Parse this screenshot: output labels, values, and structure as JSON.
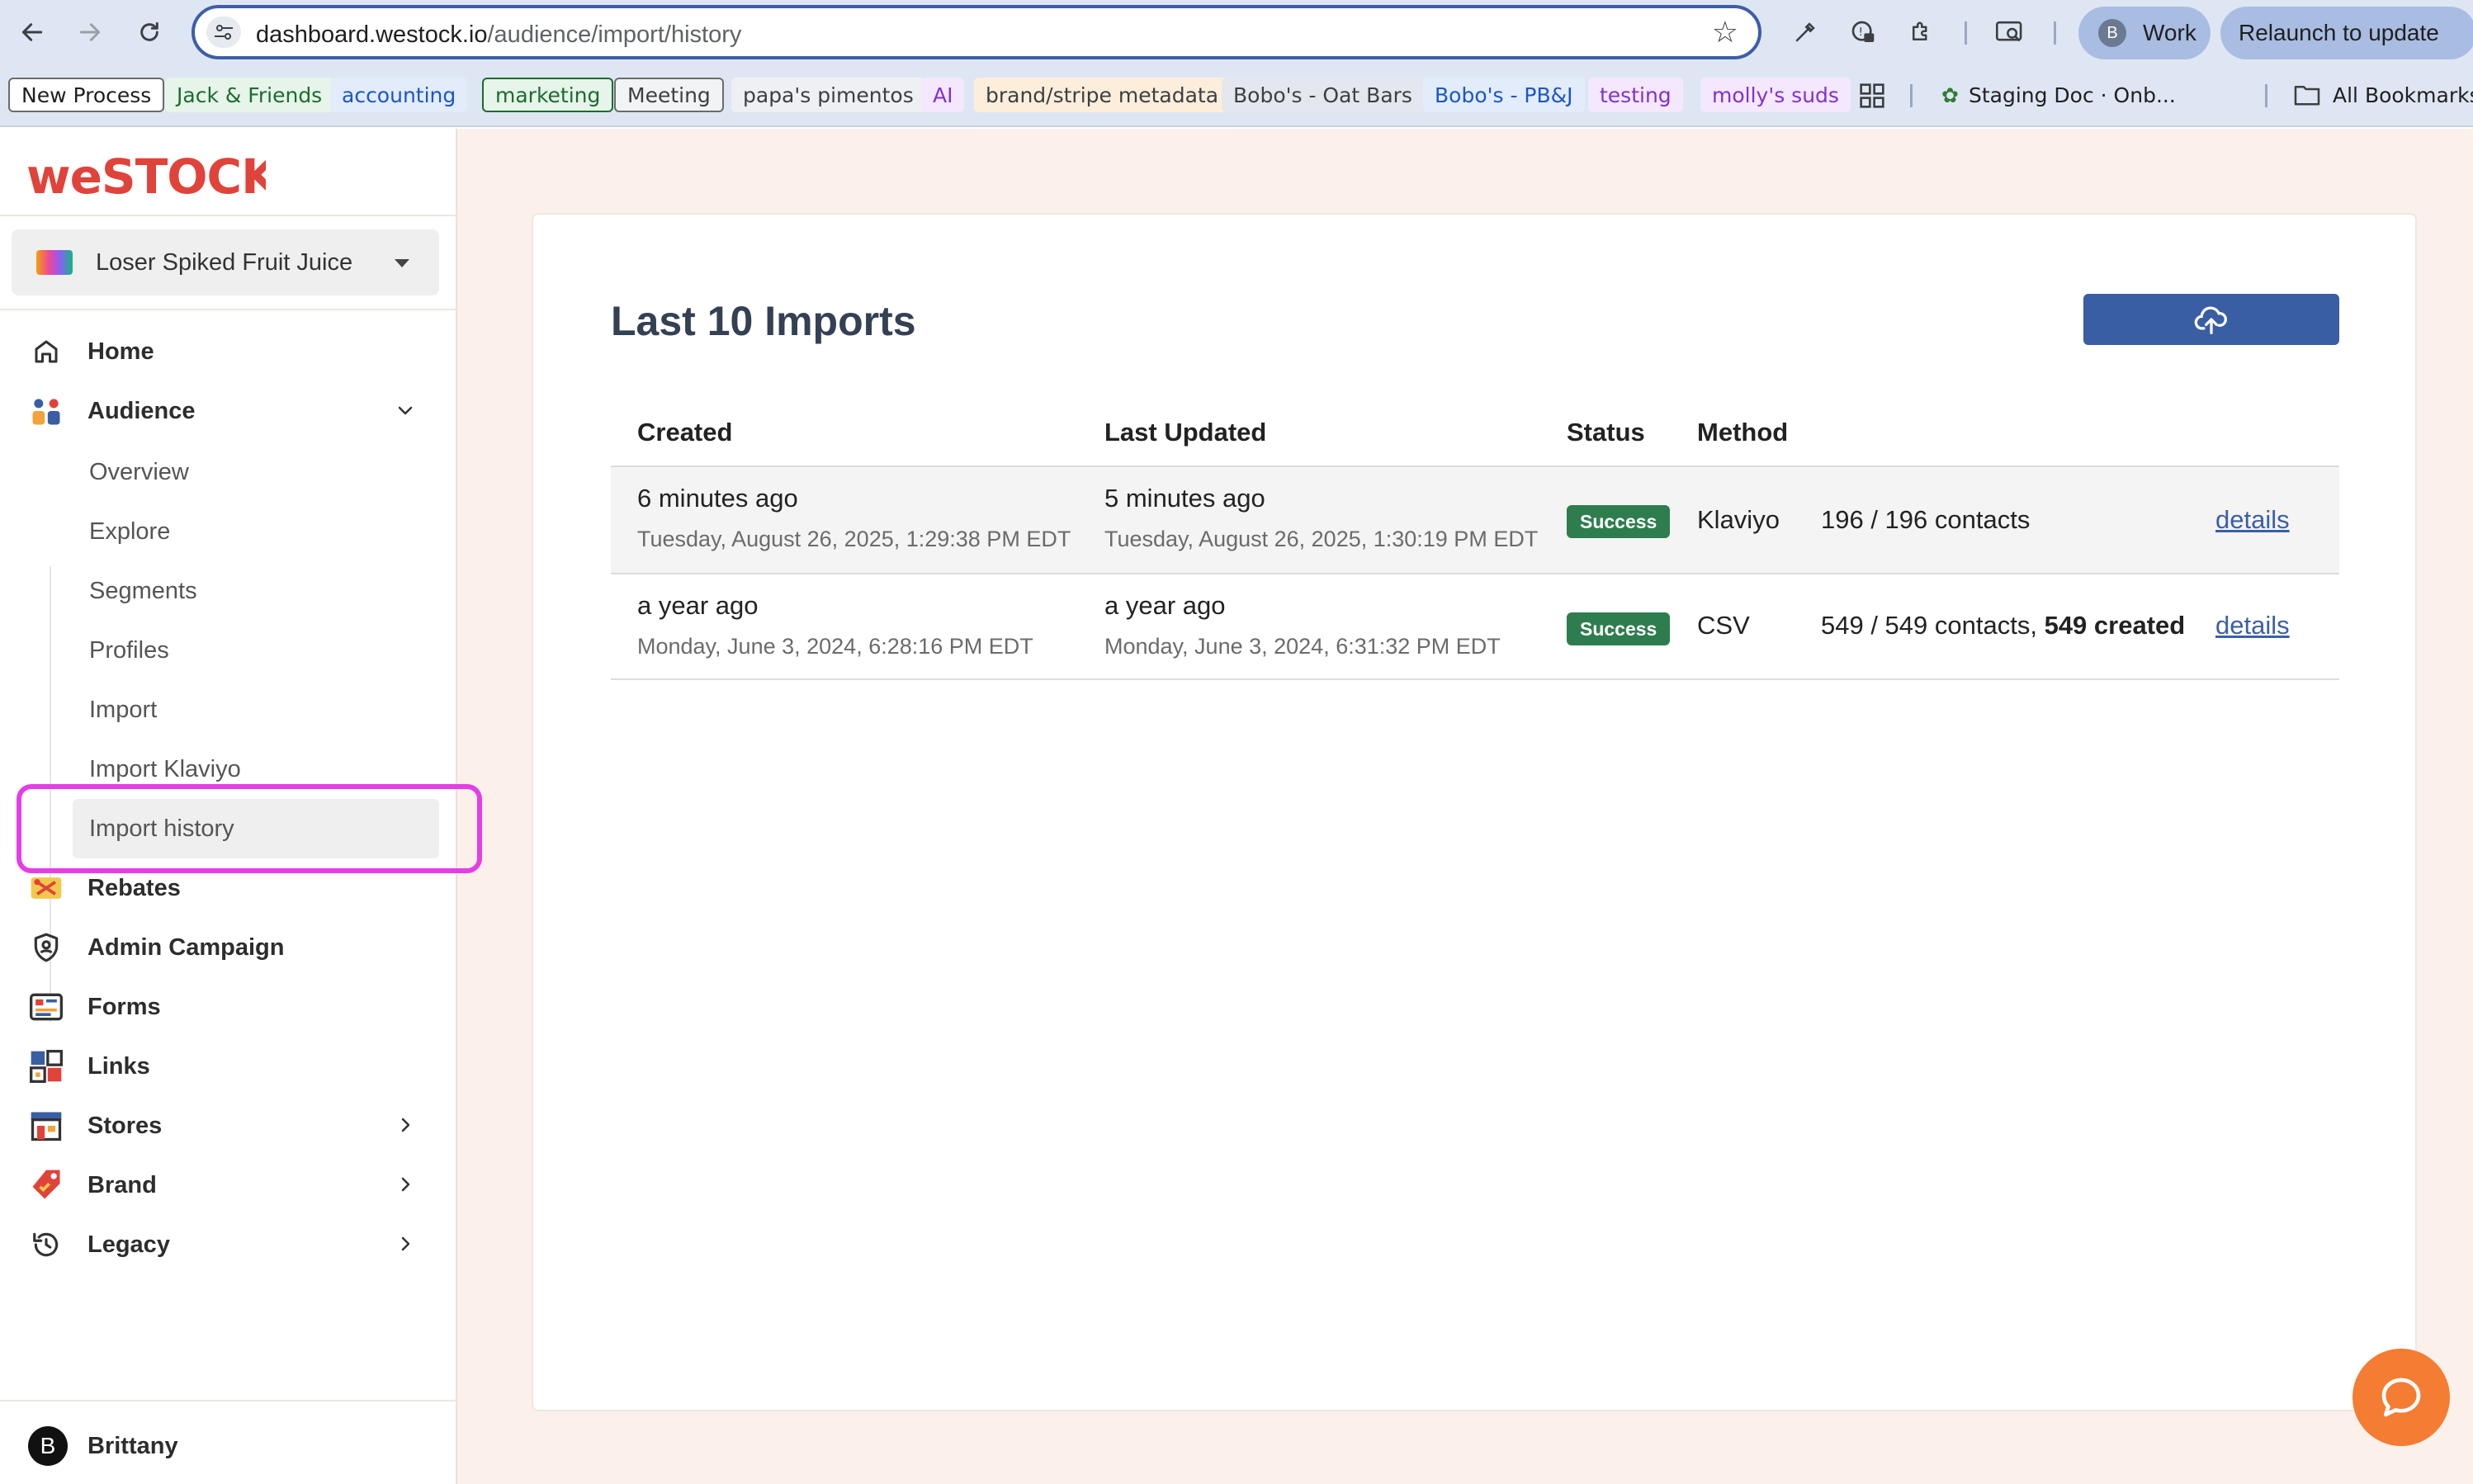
{
  "browser": {
    "url_host": "dashboard.westock.io",
    "url_path": "/audience/import/history",
    "profile_initial": "B",
    "profile_name": "Work",
    "relaunch_label": "Relaunch to update",
    "bookmarks": [
      {
        "label": "New Process",
        "color": "#1f1f1f",
        "bg": "#ffffff",
        "border": "#6b6b6b"
      },
      {
        "label": "Jack & Friends",
        "color": "#1e6b2e",
        "bg": "#e6f4ea",
        "border": "none"
      },
      {
        "label": "accounting",
        "color": "#1a56c9",
        "bg": "#e3ecfb",
        "border": "none"
      },
      {
        "label": "marketing",
        "color": "#1e6b2e",
        "bg": "#e6f4ea",
        "border": "#1e6b2e"
      },
      {
        "label": "Meeting",
        "color": "#3c4043",
        "bg": "#f1f3f4",
        "border": "#6b6b6b"
      },
      {
        "label": "papa's pimentos",
        "color": "#3c4043",
        "bg": "#eef0f3",
        "border": "none"
      },
      {
        "label": "AI",
        "color": "#8430ce",
        "bg": "#f3e8fd",
        "border": "none"
      },
      {
        "label": "brand/stripe metadata",
        "color": "#3c4043",
        "bg": "#fdeedb",
        "border": "none"
      },
      {
        "label": "Bobo's - Oat Bars",
        "color": "#3c4043",
        "bg": "#e4e8ee",
        "border": "none"
      },
      {
        "label": "Bobo's - PB&J",
        "color": "#1a56c9",
        "bg": "#e3ecfb",
        "border": "none"
      },
      {
        "label": "testing",
        "color": "#8430ce",
        "bg": "#f3e8fd",
        "border": "none"
      },
      {
        "label": "molly's suds",
        "color": "#8430ce",
        "bg": "#f3e8fd",
        "border": "none"
      }
    ],
    "staging_label": "Staging Doc · Onb...",
    "all_bookmarks_label": "All Bookmarks"
  },
  "sidebar": {
    "brand_name": "Loser Spiked Fruit Juice",
    "nav": {
      "home": "Home",
      "audience": "Audience",
      "rebates": "Rebates",
      "admin_campaign": "Admin Campaign",
      "forms": "Forms",
      "links": "Links",
      "stores": "Stores",
      "brand": "Brand",
      "legacy": "Legacy"
    },
    "audience_sub": {
      "overview": "Overview",
      "explore": "Explore",
      "segments": "Segments",
      "profiles": "Profiles",
      "import": "Import",
      "import_klaviyo": "Import Klaviyo",
      "import_history": "Import history"
    },
    "user_initial": "B",
    "user_name": "Brittany"
  },
  "main": {
    "title": "Last 10 Imports",
    "columns": {
      "created": "Created",
      "last_updated": "Last Updated",
      "status": "Status",
      "method": "Method"
    },
    "rows": [
      {
        "created_rel": "6 minutes ago",
        "created_abs": "Tuesday, August 26, 2025, 1:29:38 PM EDT",
        "updated_rel": "5 minutes ago",
        "updated_abs": "Tuesday, August 26, 2025, 1:30:19 PM EDT",
        "status": "Success",
        "method": "Klaviyo",
        "summary": "196 / 196 contacts",
        "created_note": "",
        "details": "details"
      },
      {
        "created_rel": "a year ago",
        "created_abs": "Monday, June 3, 2024, 6:28:16 PM EDT",
        "updated_rel": "a year ago",
        "updated_abs": "Monday, June 3, 2024, 6:31:32 PM EDT",
        "status": "Success",
        "method": "CSV",
        "summary": "549 / 549 contacts, ",
        "created_note": "549 created",
        "details": "details"
      }
    ]
  },
  "colors": {
    "accent": "#3a5ea3",
    "success": "#2e7d4f",
    "highlight": "#e43ee6",
    "chat": "#f57c33",
    "logo": "#e0433a"
  }
}
